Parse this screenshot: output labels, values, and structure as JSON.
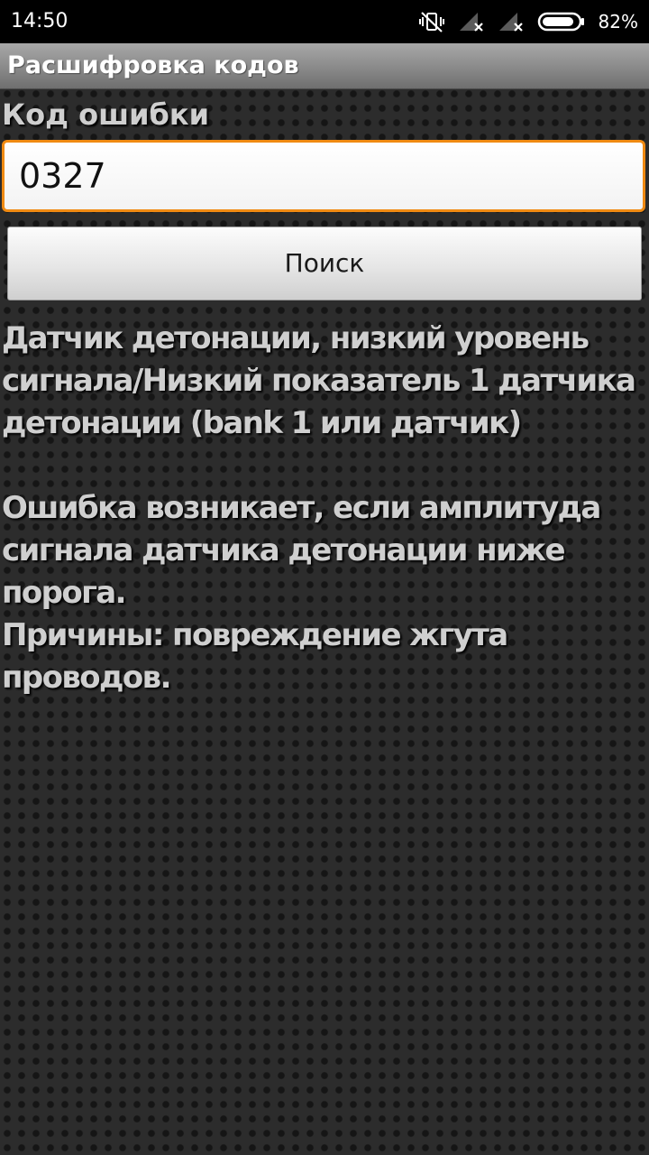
{
  "status_bar": {
    "time": "14:50",
    "battery_percent": "82%",
    "icons": [
      "vibrate-off-icon",
      "signal-no-service-icon",
      "signal-no-service-icon",
      "battery-icon"
    ]
  },
  "app": {
    "title": "Расшифровка кодов"
  },
  "form": {
    "label": "Код ошибки",
    "code_value": "0327",
    "search_label": "Поиск",
    "accent_color": "#f08a12"
  },
  "result": {
    "description": "Датчик детонации, низкий уровень сигнала/Низкий показатель 1 датчика детонации (bank 1 или датчик)",
    "condition": "Ошибка возникает, если амплитуда сигнала датчика детонации ниже порога.",
    "causes": "Причины: повреждение жгута проводов."
  }
}
